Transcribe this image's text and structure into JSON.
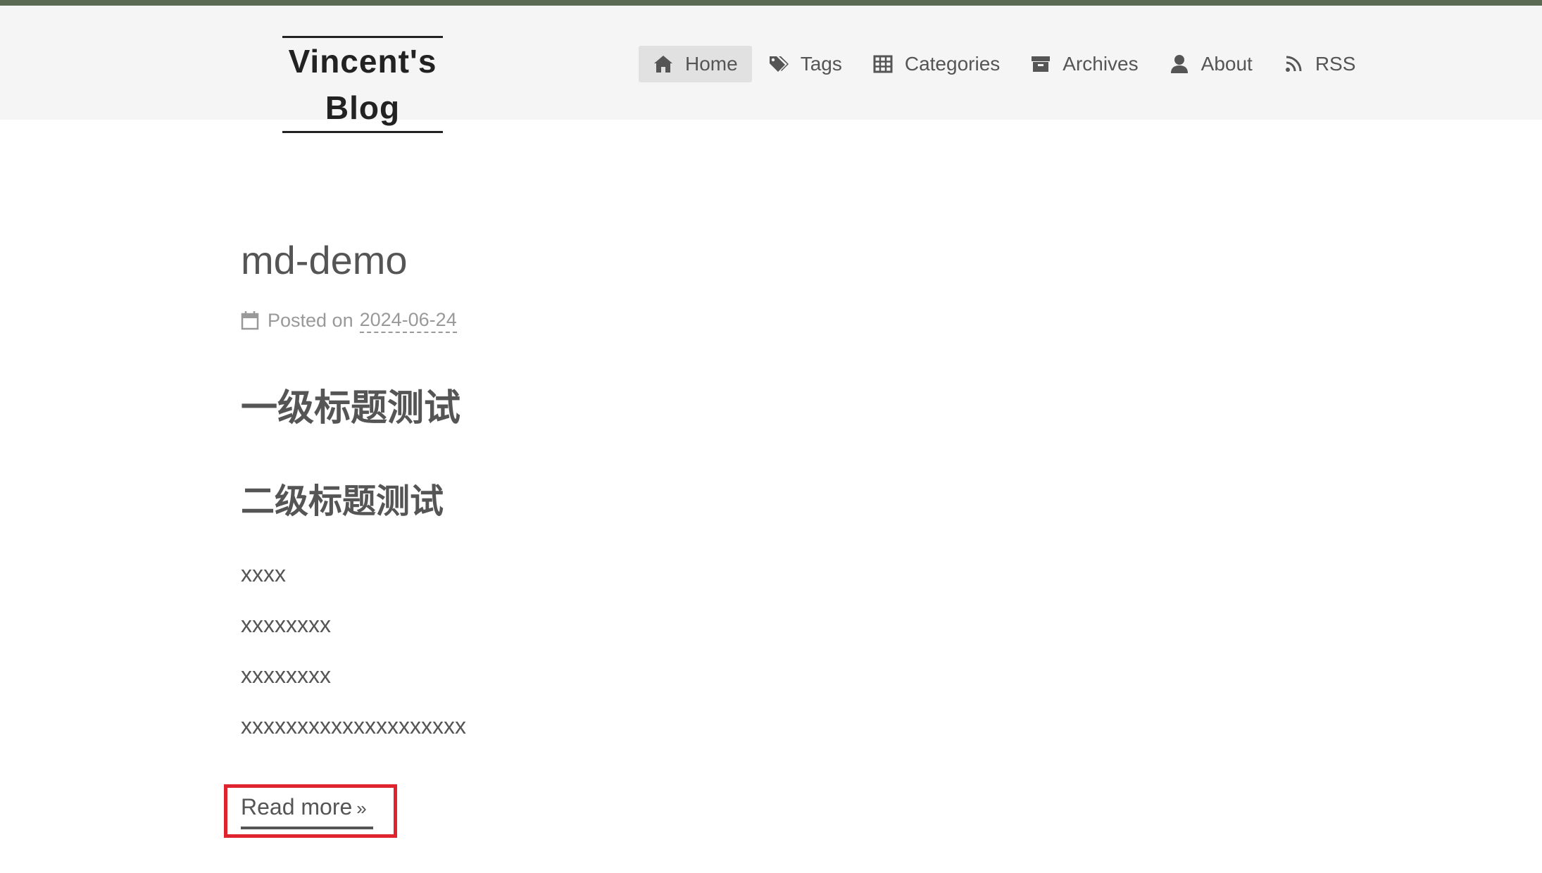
{
  "site": {
    "brand": "Vincent's Blog"
  },
  "nav": {
    "items": [
      {
        "label": "Home",
        "icon": "home-icon",
        "active": true
      },
      {
        "label": "Tags",
        "icon": "tags-icon",
        "active": false
      },
      {
        "label": "Categories",
        "icon": "grid-icon",
        "active": false
      },
      {
        "label": "Archives",
        "icon": "archive-icon",
        "active": false
      },
      {
        "label": "About",
        "icon": "user-icon",
        "active": false
      },
      {
        "label": "RSS",
        "icon": "rss-icon",
        "active": false
      }
    ]
  },
  "post": {
    "title": "md-demo",
    "meta_prefix": "Posted on",
    "date": "2024-06-24",
    "h1": "一级标题测试",
    "h2": "二级标题测试",
    "paragraphs": [
      "xxxx",
      "xxxxxxxx",
      "xxxxxxxx",
      "xxxxxxxxxxxxxxxxxxxx"
    ],
    "read_more": "Read more",
    "read_more_chevron": "»"
  },
  "colors": {
    "accent_bar": "#5b6b53",
    "header_bg": "#f5f5f5",
    "active_nav_bg": "#e1e1e1",
    "highlight_box": "#e0242f",
    "text": "#555555",
    "meta_text": "#999999"
  }
}
